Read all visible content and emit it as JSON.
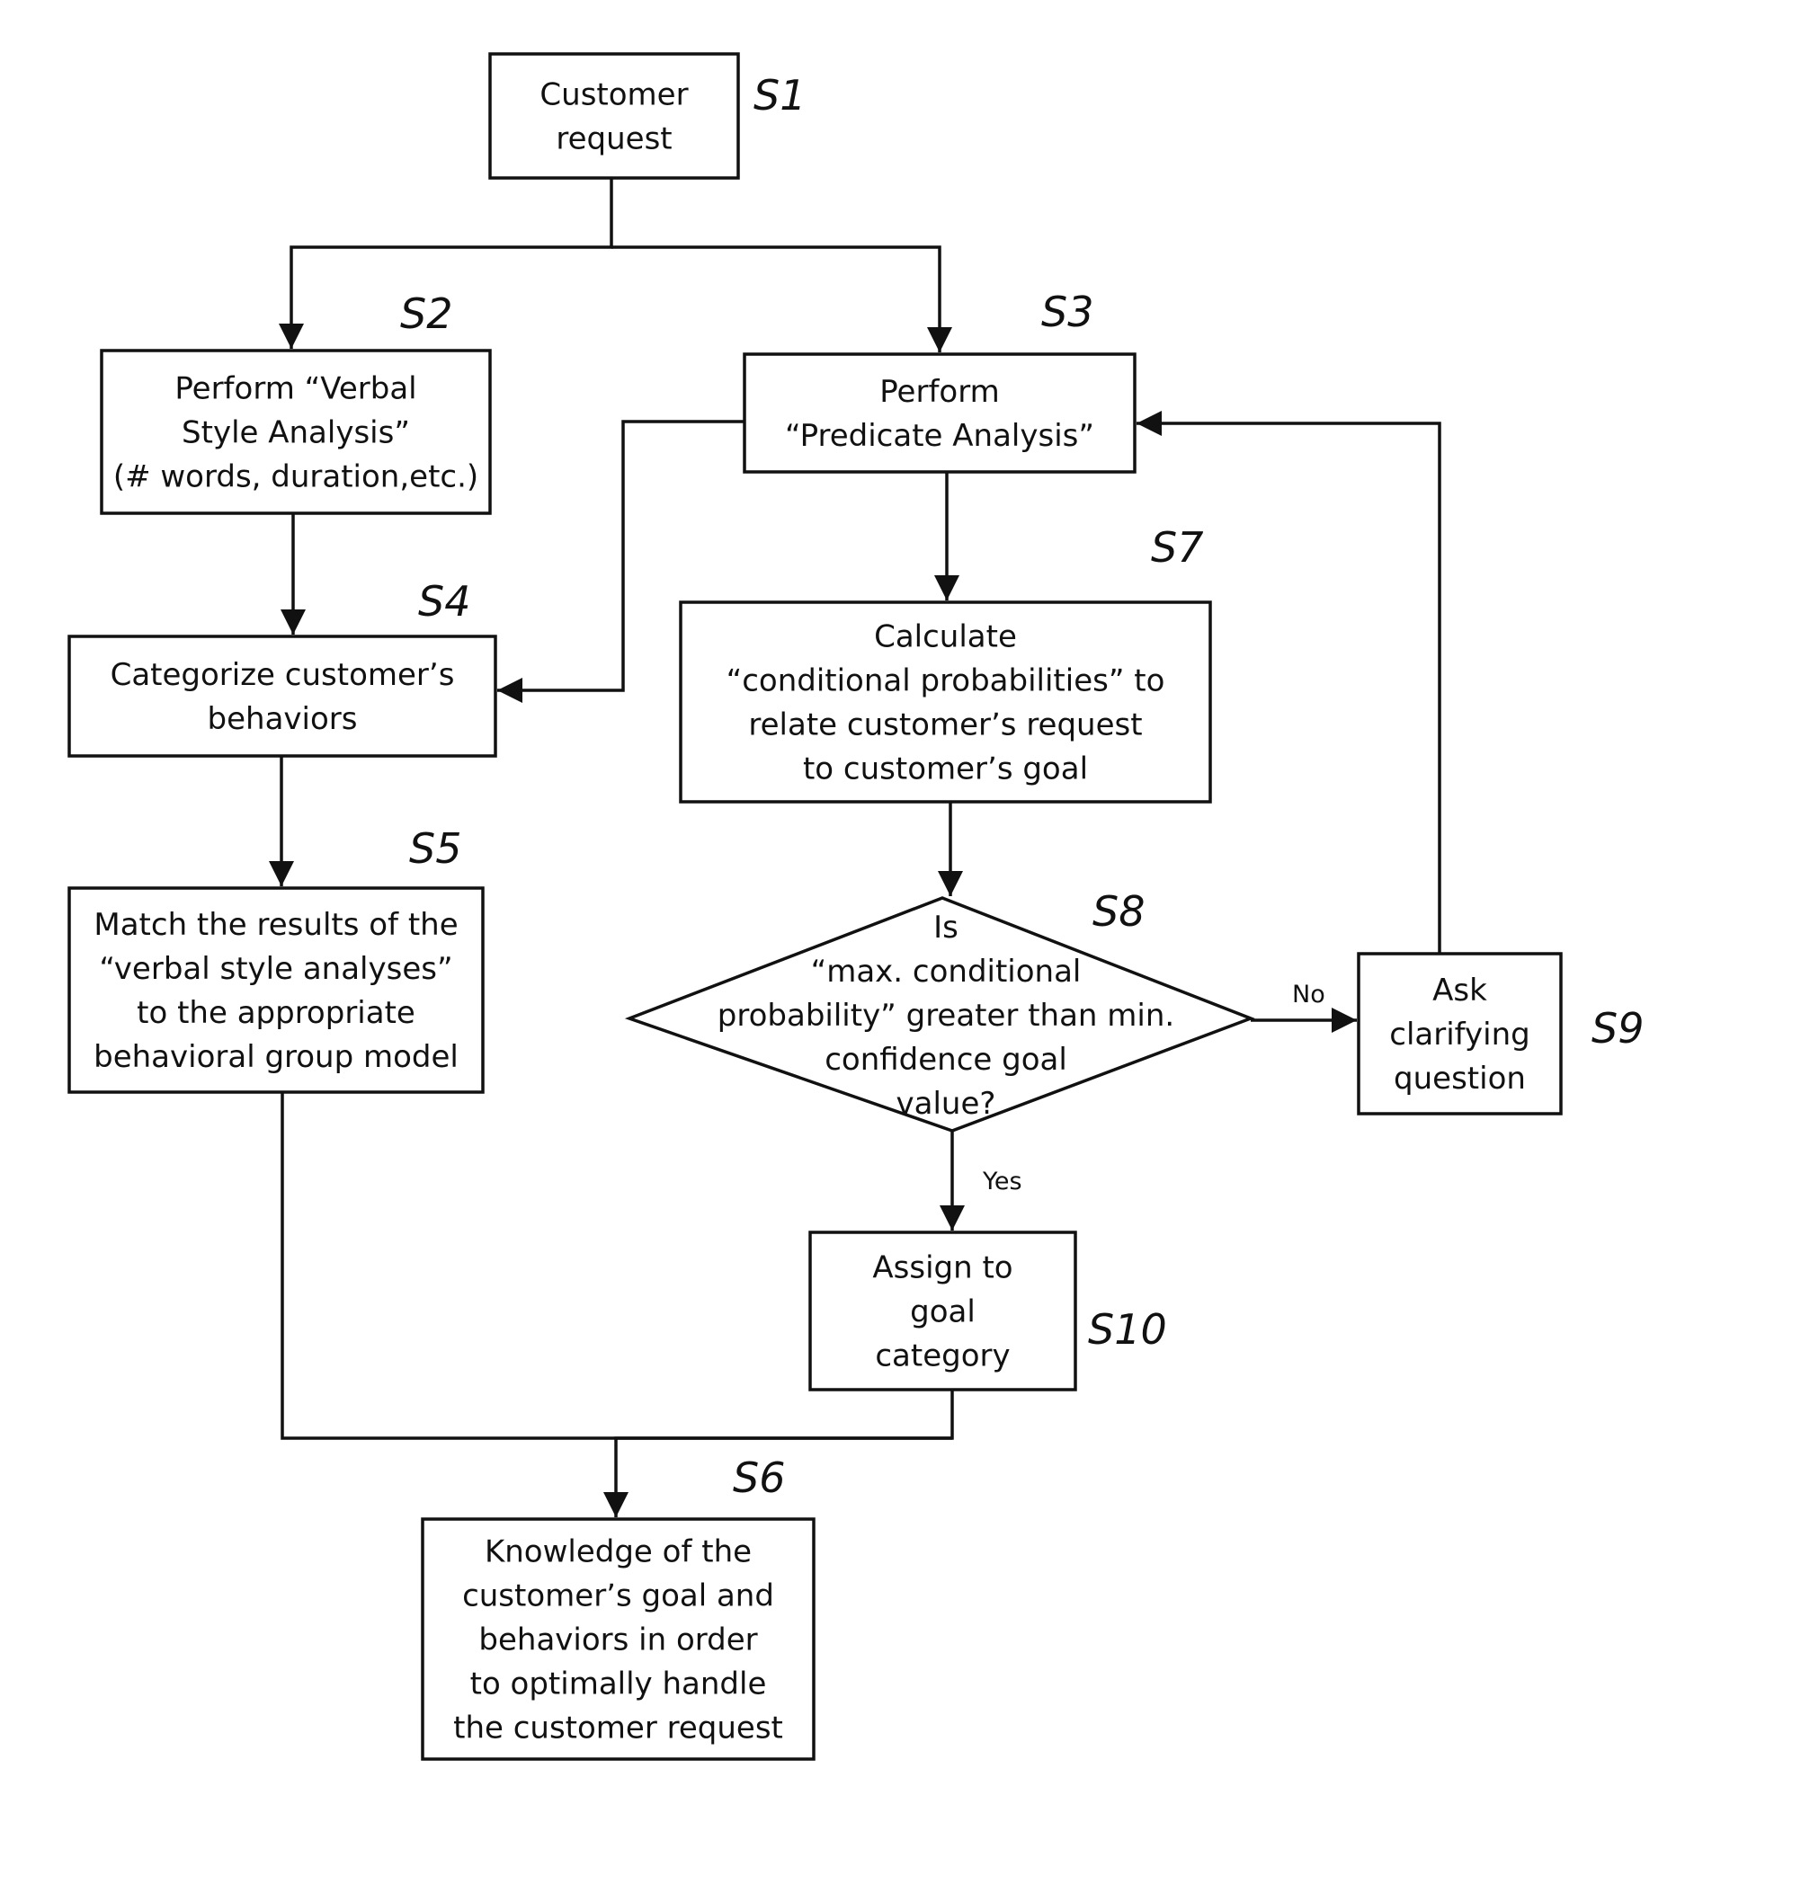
{
  "diagram": {
    "type": "flowchart",
    "nodes": [
      {
        "id": "S1",
        "step": "S1",
        "shape": "box",
        "lines": [
          "Customer",
          "request"
        ]
      },
      {
        "id": "S2",
        "step": "S2",
        "shape": "box",
        "lines": [
          "Perform “Verbal",
          "Style Analysis”",
          "(# words, duration,etc.)"
        ]
      },
      {
        "id": "S3",
        "step": "S3",
        "shape": "box",
        "lines": [
          "Perform",
          "“Predicate Analysis”"
        ]
      },
      {
        "id": "S4",
        "step": "S4",
        "shape": "box",
        "lines": [
          "Categorize customer’s",
          "behaviors"
        ]
      },
      {
        "id": "S7",
        "step": "S7",
        "shape": "box",
        "lines": [
          "Calculate",
          "“conditional probabilities” to",
          "relate customer’s request",
          "to customer’s goal"
        ]
      },
      {
        "id": "S5",
        "step": "S5",
        "shape": "box",
        "lines": [
          "Match the results of the",
          "“verbal style analyses”",
          "to the appropriate",
          "behavioral group model"
        ]
      },
      {
        "id": "S8",
        "step": "S8",
        "shape": "diamond",
        "lines": [
          "Is",
          "“max. conditional",
          "probability” greater than min.",
          "confidence goal",
          "value?"
        ]
      },
      {
        "id": "S9",
        "step": "S9",
        "shape": "box",
        "lines": [
          "Ask",
          "clarifying",
          "question"
        ]
      },
      {
        "id": "S10",
        "step": "S10",
        "shape": "box",
        "lines": [
          "Assign to",
          "goal",
          "category"
        ]
      },
      {
        "id": "S6",
        "step": "S6",
        "shape": "box",
        "lines": [
          "Knowledge of the",
          "customer’s goal and",
          "behaviors in order",
          "to optimally handle",
          "the customer request"
        ]
      }
    ],
    "edges": [
      {
        "from": "S1",
        "to": "S2",
        "label": ""
      },
      {
        "from": "S1",
        "to": "S3",
        "label": ""
      },
      {
        "from": "S2",
        "to": "S4",
        "label": ""
      },
      {
        "from": "S3",
        "to": "S4",
        "label": ""
      },
      {
        "from": "S3",
        "to": "S7",
        "label": ""
      },
      {
        "from": "S4",
        "to": "S5",
        "label": ""
      },
      {
        "from": "S7",
        "to": "S8",
        "label": ""
      },
      {
        "from": "S8",
        "to": "S9",
        "label": "No"
      },
      {
        "from": "S9",
        "to": "S3",
        "label": ""
      },
      {
        "from": "S8",
        "to": "S10",
        "label": "Yes"
      },
      {
        "from": "S5",
        "to": "S6",
        "label": ""
      },
      {
        "from": "S10",
        "to": "S6",
        "label": ""
      }
    ]
  }
}
